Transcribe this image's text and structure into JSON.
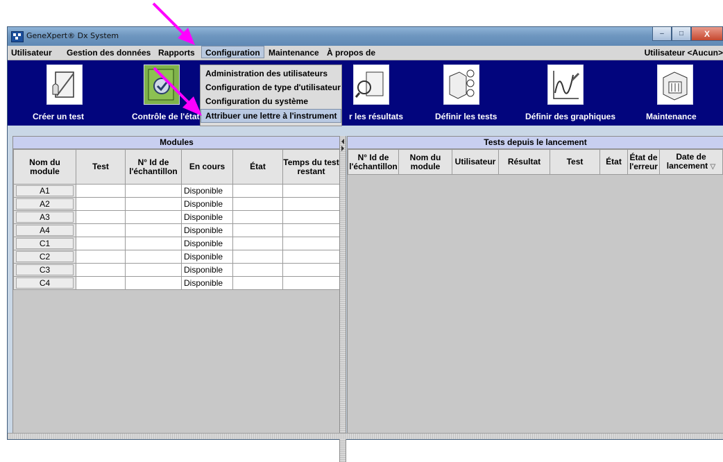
{
  "window": {
    "title": "GeneXpert® Dx System",
    "buttons": [
      "–",
      "□",
      "X"
    ]
  },
  "menubar": {
    "items": [
      "Utilisateur",
      "Gestion des données",
      "Rapports",
      "Configuration",
      "Maintenance",
      "À propos de"
    ],
    "active": "Configuration",
    "user_status": "Utilisateur <Aucun>"
  },
  "toolbar": {
    "buttons": [
      {
        "label": "Créer un test",
        "icon": "create-test-icon"
      },
      {
        "label": "Contrôle de l'état",
        "icon": "check-status-icon"
      },
      {
        "label": "r les résultats",
        "icon": "view-results-icon"
      },
      {
        "label": "Définir les tests",
        "icon": "define-tests-icon"
      },
      {
        "label": "Définir des graphiques",
        "icon": "define-graphs-icon"
      },
      {
        "label": "Maintenance",
        "icon": "maintenance-icon"
      }
    ],
    "bg_color": "#02057d"
  },
  "dropdown": {
    "items": [
      "Administration des utilisateurs",
      "Configuration de type d'utilisateur",
      "Configuration du système",
      "Attribuer une lettre à l'instrument"
    ],
    "highlighted": "Attribuer une lettre à l'instrument"
  },
  "modules_panel": {
    "title": "Modules",
    "columns": [
      "Nom du module",
      "Test",
      "N° Id de l'échantillon",
      "En cours",
      "État",
      "Temps du test restant"
    ],
    "rows": [
      {
        "module": "A1",
        "test": "",
        "sample_id": "",
        "status": "Disponible",
        "state": "",
        "time_left": ""
      },
      {
        "module": "A2",
        "test": "",
        "sample_id": "",
        "status": "Disponible",
        "state": "",
        "time_left": ""
      },
      {
        "module": "A3",
        "test": "",
        "sample_id": "",
        "status": "Disponible",
        "state": "",
        "time_left": ""
      },
      {
        "module": "A4",
        "test": "",
        "sample_id": "",
        "status": "Disponible",
        "state": "",
        "time_left": ""
      },
      {
        "module": "C1",
        "test": "",
        "sample_id": "",
        "status": "Disponible",
        "state": "",
        "time_left": ""
      },
      {
        "module": "C2",
        "test": "",
        "sample_id": "",
        "status": "Disponible",
        "state": "",
        "time_left": ""
      },
      {
        "module": "C3",
        "test": "",
        "sample_id": "",
        "status": "Disponible",
        "state": "",
        "time_left": ""
      },
      {
        "module": "C4",
        "test": "",
        "sample_id": "",
        "status": "Disponible",
        "state": "",
        "time_left": ""
      }
    ]
  },
  "tests_panel": {
    "title": "Tests depuis le lancement",
    "columns": [
      "N° Id de l'échantillon",
      "Nom du module",
      "Utilisateur",
      "Résultat",
      "Test",
      "État",
      "État de l'erreur",
      "Date de lancement"
    ],
    "sort_glyph": "▽",
    "rows": []
  },
  "annotation_color": "#ff00ff"
}
